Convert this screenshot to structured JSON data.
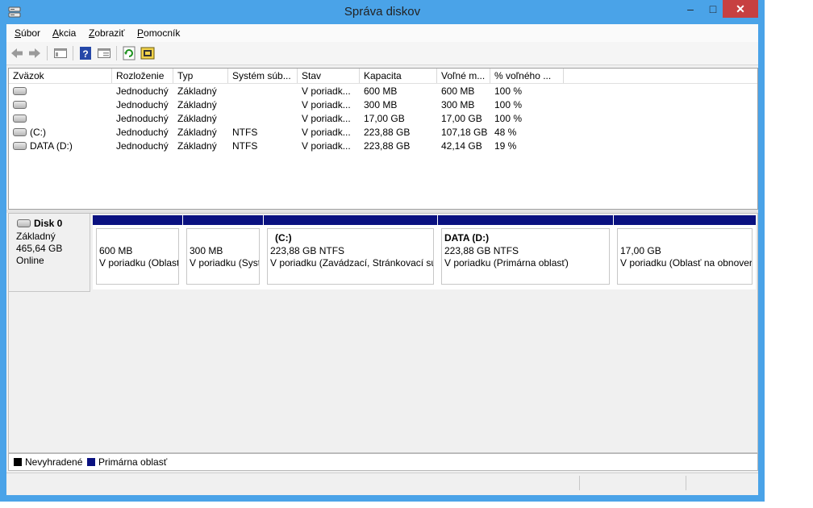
{
  "window": {
    "title": "Správa diskov",
    "controls": {
      "minimize": "–",
      "maximize": "□",
      "close": "✕"
    }
  },
  "menu": [
    {
      "label": "Súbor",
      "accel": "S",
      "rest": "úbor"
    },
    {
      "label": "Akcia",
      "accel": "A",
      "rest": "kcia"
    },
    {
      "label": "Zobraziť",
      "accel": "Z",
      "rest": "obraziť"
    },
    {
      "label": "Pomocník",
      "accel": "P",
      "rest": "omocník"
    }
  ],
  "toolbar": [
    "back-icon",
    "forward-icon",
    "console-tree-icon",
    "help-icon",
    "properties-icon",
    "refresh-icon",
    "rescan-icon"
  ],
  "volume_table": {
    "columns": [
      "Zväzok",
      "Rozloženie",
      "Typ",
      "Systém súb...",
      "Stav",
      "Kapacita",
      "Voľné m...",
      "% voľného ..."
    ],
    "rows": [
      {
        "volume": "",
        "layout": "Jednoduchý",
        "type": "Základný",
        "fs": "",
        "status": "V poriadk...",
        "capacity": "600 MB",
        "free": "600 MB",
        "pct": "100 %"
      },
      {
        "volume": "",
        "layout": "Jednoduchý",
        "type": "Základný",
        "fs": "",
        "status": "V poriadk...",
        "capacity": "300 MB",
        "free": "300 MB",
        "pct": "100 %"
      },
      {
        "volume": "",
        "layout": "Jednoduchý",
        "type": "Základný",
        "fs": "",
        "status": "V poriadk...",
        "capacity": "17,00 GB",
        "free": "17,00 GB",
        "pct": "100 %"
      },
      {
        "volume": "(C:)",
        "layout": "Jednoduchý",
        "type": "Základný",
        "fs": "NTFS",
        "status": "V poriadk...",
        "capacity": "223,88 GB",
        "free": "107,18 GB",
        "pct": "48 %"
      },
      {
        "volume": "DATA (D:)",
        "layout": "Jednoduchý",
        "type": "Základný",
        "fs": "NTFS",
        "status": "V poriadk...",
        "capacity": "223,88 GB",
        "free": "42,14 GB",
        "pct": "19 %"
      }
    ]
  },
  "disk": {
    "name": "Disk 0",
    "type": "Základný",
    "size": "465,64 GB",
    "status": "Online"
  },
  "partitions": [
    {
      "title": "",
      "size": "600 MB",
      "status": "V poriadku (Oblasť"
    },
    {
      "title": "",
      "size": "300 MB",
      "status": "V poriadku (Syst"
    },
    {
      "title": "(C:)",
      "size": "223,88 GB NTFS",
      "status": "V poriadku (Zavádzací, Stránkovací súb"
    },
    {
      "title": "DATA  (D:)",
      "size": "223,88 GB NTFS",
      "status": "V poriadku (Primárna oblasť)"
    },
    {
      "title": "",
      "size": "17,00 GB",
      "status": "V poriadku (Oblasť na obnover"
    }
  ],
  "legend": [
    {
      "label": "Nevyhradené",
      "color": "#000000"
    },
    {
      "label": "Primárna oblasť",
      "color": "#0a1180"
    }
  ],
  "colors": {
    "accent": "#4aa3e8",
    "primary_partition": "#0a1180",
    "close": "#c74041"
  }
}
